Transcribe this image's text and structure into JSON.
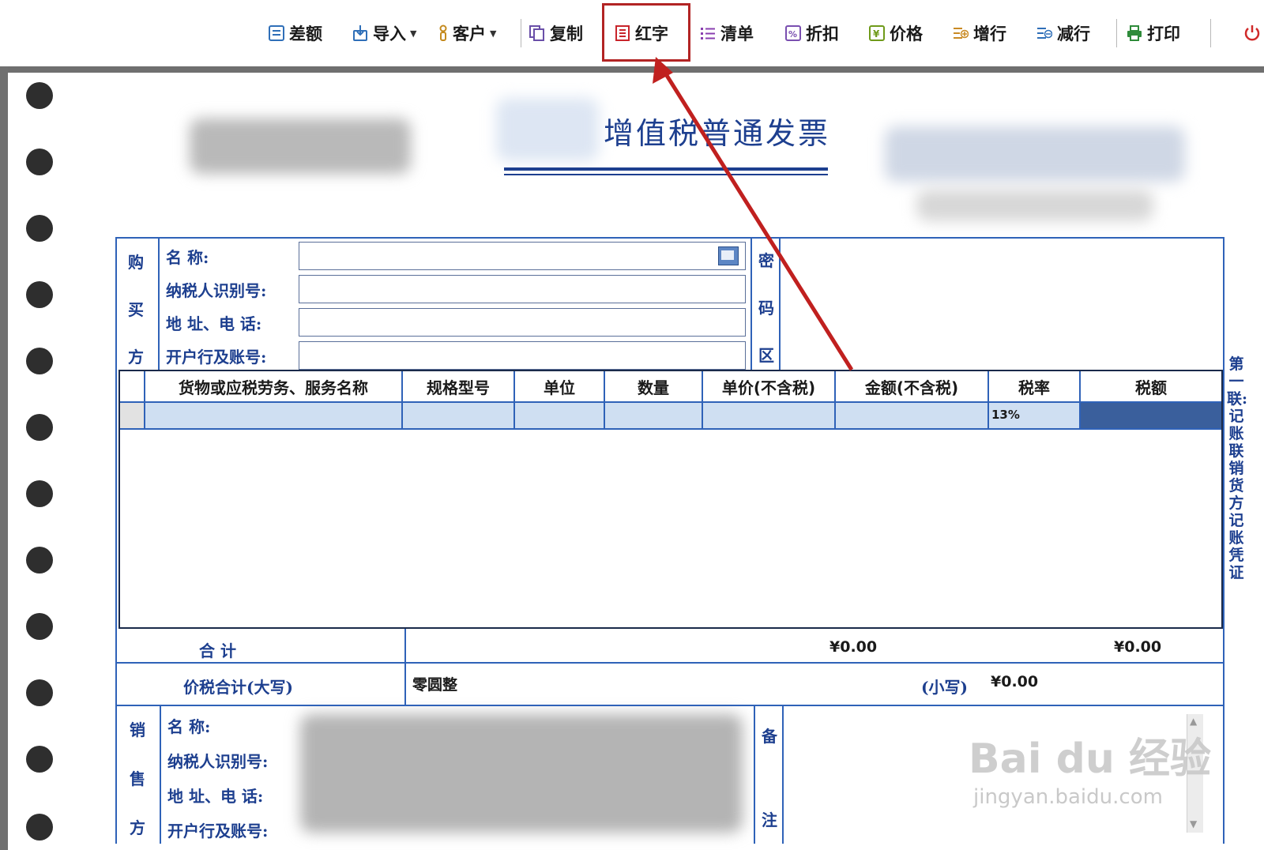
{
  "toolbar": {
    "items": [
      {
        "label": "差额",
        "icon": "difference-icon"
      },
      {
        "label": "导入",
        "icon": "import-icon",
        "dropdown": true
      },
      {
        "label": "客户",
        "icon": "customer-icon",
        "dropdown": true
      },
      {
        "label": "复制",
        "icon": "copy-icon"
      },
      {
        "label": "红字",
        "icon": "red-invoice-icon"
      },
      {
        "label": "清单",
        "icon": "list-icon"
      },
      {
        "label": "折扣",
        "icon": "discount-icon"
      },
      {
        "label": "价格",
        "icon": "price-icon"
      },
      {
        "label": "增行",
        "icon": "add-row-icon"
      },
      {
        "label": "减行",
        "icon": "remove-row-icon"
      },
      {
        "label": "打印",
        "icon": "print-icon"
      }
    ],
    "highlighted_item": "红字",
    "highlight_color": "#b22424"
  },
  "invoice": {
    "title": "增值税普通发票",
    "buyer": {
      "section_chars": [
        "购",
        "买",
        "方"
      ],
      "name_label": "名        称:",
      "taxid_label": "纳税人识别号:",
      "address_label": "地 址、电 话:",
      "bank_label": "开户行及账号:"
    },
    "cipher_area_chars": [
      "密",
      "码",
      "区"
    ],
    "items_table": {
      "headers": [
        "货物或应税劳务、服务名称",
        "规格型号",
        "单位",
        "数量",
        "单价(不含税)",
        "金额(不含税)",
        "税率",
        "税额"
      ],
      "rows": [
        {
          "name": "",
          "spec": "",
          "unit": "",
          "qty": "",
          "price": "",
          "amount": "",
          "tax_rate": "13%",
          "tax": ""
        }
      ]
    },
    "total_label": "合          计",
    "total_amount": "¥0.00",
    "total_tax": "¥0.00",
    "grand_total_label": "价税合计(大写)",
    "grand_total_words": "零圆整",
    "grand_total_small_label": "(小写)",
    "grand_total_small": "¥0.00",
    "seller": {
      "section_chars": [
        "销",
        "售",
        "方"
      ],
      "name_label": "名        称:",
      "taxid_label": "纳税人识别号:",
      "address_label": "地 址、电 话:",
      "bank_label": "开户行及账号:"
    },
    "remarks_chars": [
      "备",
      "注"
    ],
    "side_note": "第一联:记账联 销货方记账凭证"
  },
  "watermark": {
    "main": "Bai du 经验",
    "sub": "jingyan.baidu.com"
  },
  "colors": {
    "form_blue": "#1d3f8f",
    "line_blue": "#2f62b8",
    "row_fill": "#cfdff2",
    "selected_cell": "#3a5f9c",
    "arrow_red": "#c0201f"
  }
}
